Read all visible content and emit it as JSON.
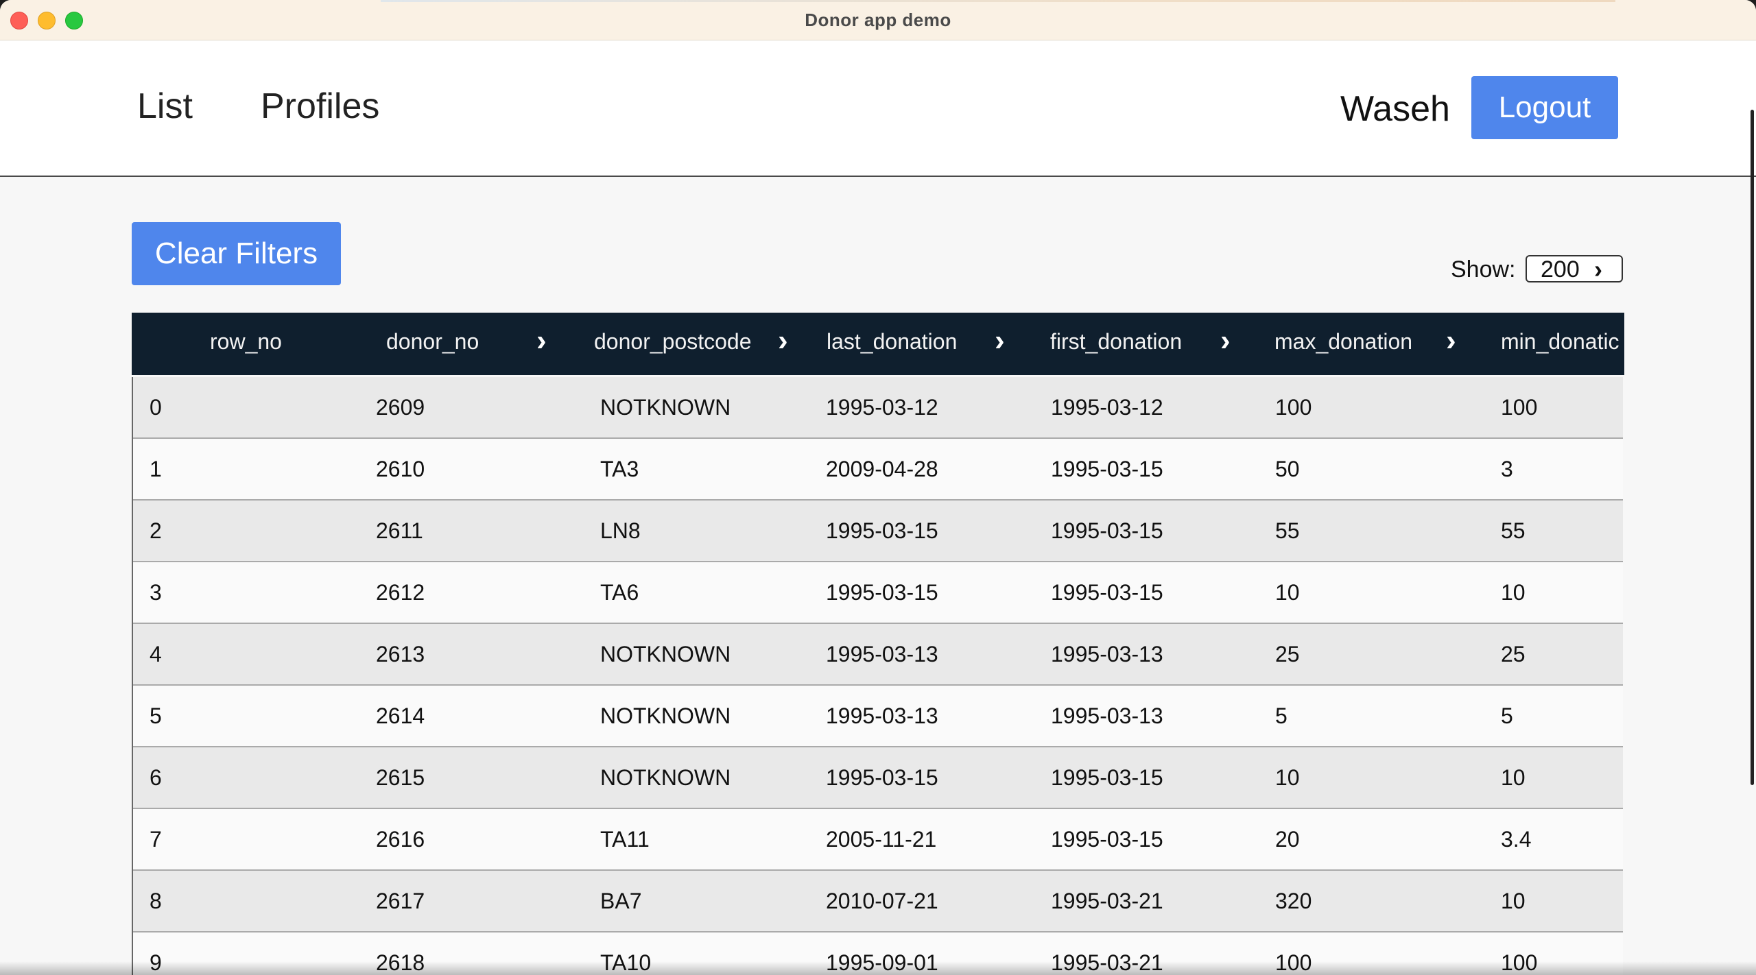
{
  "window": {
    "title": "Donor app demo"
  },
  "nav": {
    "links": [
      "List",
      "Profiles"
    ],
    "user": "Waseh",
    "logout_label": "Logout"
  },
  "controls": {
    "clear_filters_label": "Clear Filters",
    "show_label": "Show:",
    "show_value": "200"
  },
  "table": {
    "columns": [
      "row_no",
      "donor_no",
      "donor_postcode",
      "last_donation",
      "first_donation",
      "max_donation",
      "min_donatic"
    ],
    "rows": [
      [
        "0",
        "2609",
        "NOTKNOWN",
        "1995-03-12",
        "1995-03-12",
        "100",
        "100"
      ],
      [
        "1",
        "2610",
        "TA3",
        "2009-04-28",
        "1995-03-15",
        "50",
        "3"
      ],
      [
        "2",
        "2611",
        "LN8",
        "1995-03-15",
        "1995-03-15",
        "55",
        "55"
      ],
      [
        "3",
        "2612",
        "TA6",
        "1995-03-15",
        "1995-03-15",
        "10",
        "10"
      ],
      [
        "4",
        "2613",
        "NOTKNOWN",
        "1995-03-13",
        "1995-03-13",
        "25",
        "25"
      ],
      [
        "5",
        "2614",
        "NOTKNOWN",
        "1995-03-13",
        "1995-03-13",
        "5",
        "5"
      ],
      [
        "6",
        "2615",
        "NOTKNOWN",
        "1995-03-15",
        "1995-03-15",
        "10",
        "10"
      ],
      [
        "7",
        "2616",
        "TA11",
        "2005-11-21",
        "1995-03-15",
        "20",
        "3.4"
      ],
      [
        "8",
        "2617",
        "BA7",
        "2010-07-21",
        "1995-03-21",
        "320",
        "10"
      ],
      [
        "9",
        "2618",
        "TA10",
        "1995-09-01",
        "1995-03-21",
        "100",
        "100"
      ]
    ]
  },
  "icons": {
    "sort": "chevron-right-icon",
    "select": "chevron-right-icon"
  }
}
